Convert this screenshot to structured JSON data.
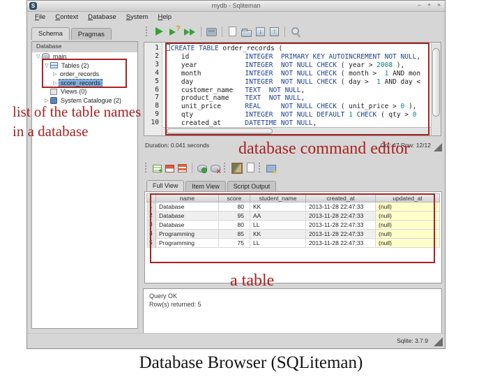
{
  "window": {
    "title": "mydb - Sqliteman",
    "app_icon": "S",
    "controls": [
      "–",
      "+",
      "×"
    ],
    "menu": [
      "File",
      "Context",
      "Database",
      "System",
      "Help"
    ],
    "schema_tabs": [
      {
        "label": "Schema",
        "active": true
      },
      {
        "label": "Pragmas",
        "active": false
      }
    ]
  },
  "toolbar_main": {
    "icons": [
      {
        "name": "toolbar-grip",
        "kind": "grip"
      },
      {
        "name": "run-sql-icon",
        "kind": "run"
      },
      {
        "name": "explain-query-icon",
        "kind": "explain"
      },
      {
        "name": "run-all-icon",
        "kind": "runall"
      },
      {
        "name": "separator",
        "kind": "sep"
      },
      {
        "name": "sql-console-icon",
        "kind": "console"
      },
      {
        "name": "separator",
        "kind": "sep"
      },
      {
        "name": "new-file-icon",
        "kind": "new"
      },
      {
        "name": "open-file-icon",
        "kind": "open"
      },
      {
        "name": "save-icon",
        "kind": "save"
      },
      {
        "name": "save-as-icon",
        "kind": "saveas"
      },
      {
        "name": "separator",
        "kind": "sep"
      },
      {
        "name": "search-icon",
        "kind": "search"
      }
    ]
  },
  "sidebar": {
    "header": "Database",
    "tree": [
      {
        "label": "main",
        "indent": 0,
        "expander": "open",
        "icon": "database-icon",
        "selected": false
      },
      {
        "label": "Tables (2)",
        "indent": 1,
        "expander": "open",
        "icon": "table-icon",
        "selected": false
      },
      {
        "label": "order_records",
        "indent": 2,
        "expander": "closed",
        "icon": "",
        "selected": false
      },
      {
        "label": "score_records",
        "indent": 2,
        "expander": "closed",
        "icon": "",
        "selected": true
      },
      {
        "label": "Views (0)",
        "indent": 1,
        "expander": "none",
        "icon": "views-icon",
        "selected": false
      },
      {
        "label": "System Catalogue (2)",
        "indent": 1,
        "expander": "closed",
        "icon": "catalogue-icon",
        "selected": false
      }
    ]
  },
  "editor": {
    "lines": [
      {
        "num": "1",
        "segs": [
          [
            "b",
            ""
          ],
          [
            "k",
            "CREATE"
          ],
          [
            "c",
            " "
          ],
          [
            "k",
            "TABLE"
          ],
          [
            "c",
            " order_records ("
          ]
        ]
      },
      {
        "num": "2",
        "segs": [
          [
            "c",
            "    id              "
          ],
          [
            "k",
            "INTEGER"
          ],
          [
            "c",
            "  "
          ],
          [
            "k",
            "PRIMARY KEY AUTOINCREMENT NOT NULL"
          ],
          [
            "c",
            ","
          ]
        ]
      },
      {
        "num": "3",
        "segs": [
          [
            "c",
            "    year            "
          ],
          [
            "k",
            "INTEGER"
          ],
          [
            "c",
            "  "
          ],
          [
            "k",
            "NOT NULL CHECK"
          ],
          [
            "c",
            " ( year > "
          ],
          [
            "n",
            "2008"
          ],
          [
            "c",
            " ),"
          ]
        ]
      },
      {
        "num": "4",
        "segs": [
          [
            "c",
            "    month           "
          ],
          [
            "k",
            "INTEGER"
          ],
          [
            "c",
            "  "
          ],
          [
            "k",
            "NOT NULL CHECK"
          ],
          [
            "c",
            " ( month >  "
          ],
          [
            "n",
            "1"
          ],
          [
            "c",
            " AND mon"
          ]
        ]
      },
      {
        "num": "5",
        "segs": [
          [
            "c",
            "    day             "
          ],
          [
            "k",
            "INTEGER"
          ],
          [
            "c",
            "  "
          ],
          [
            "k",
            "NOT NULL CHECK"
          ],
          [
            "c",
            " ( day >  "
          ],
          [
            "n",
            "1"
          ],
          [
            "c",
            " AND day <"
          ]
        ]
      },
      {
        "num": "6",
        "segs": [
          [
            "c",
            "    customer_name   "
          ],
          [
            "k",
            "TEXT"
          ],
          [
            "c",
            "  "
          ],
          [
            "k",
            "NOT NULL"
          ],
          [
            "c",
            ","
          ]
        ]
      },
      {
        "num": "7",
        "segs": [
          [
            "c",
            "    product_name    "
          ],
          [
            "k",
            "TEXT"
          ],
          [
            "c",
            "  "
          ],
          [
            "k",
            "NOT NULL"
          ],
          [
            "c",
            ","
          ]
        ]
      },
      {
        "num": "8",
        "segs": [
          [
            "c",
            "    unit_price      "
          ],
          [
            "k",
            "REAL"
          ],
          [
            "c",
            "     "
          ],
          [
            "k",
            "NOT NULL CHECK"
          ],
          [
            "c",
            " ( unit_price > "
          ],
          [
            "n",
            "0"
          ],
          [
            "c",
            " ),"
          ]
        ]
      },
      {
        "num": "9",
        "segs": [
          [
            "c",
            "    qty             "
          ],
          [
            "k",
            "INTEGER"
          ],
          [
            "c",
            "  "
          ],
          [
            "k",
            "NOT NULL DEFAULT"
          ],
          [
            "c",
            " "
          ],
          [
            "n",
            "1"
          ],
          [
            "c",
            " "
          ],
          [
            "k",
            "CHECK"
          ],
          [
            "c",
            " ( qty > "
          ],
          [
            "n",
            "0"
          ]
        ]
      },
      {
        "num": "10",
        "segs": [
          [
            "c",
            "    created_at      "
          ],
          [
            "k",
            "DATETIME"
          ],
          [
            "c",
            " "
          ],
          [
            "k",
            "NOT NULL"
          ],
          [
            "c",
            ","
          ]
        ]
      }
    ]
  },
  "editor_status": {
    "left": "Duration: 0.041 seconds",
    "right": "Col: 47 Row: 12/12"
  },
  "toolbar_results": {
    "icons": [
      {
        "name": "toolbar-grip",
        "kind": "grip"
      },
      {
        "name": "add-row-icon",
        "kind": "addrow"
      },
      {
        "name": "remove-row-icon",
        "kind": "delrow"
      },
      {
        "name": "remove-all-rows-icon",
        "kind": "delrows"
      },
      {
        "name": "separator",
        "kind": "sep"
      },
      {
        "name": "commit-icon",
        "kind": "commit"
      },
      {
        "name": "rollback-icon",
        "kind": "rollback"
      },
      {
        "name": "toolbar-grip",
        "kind": "grip"
      },
      {
        "name": "blob-preview-icon",
        "kind": "blob"
      },
      {
        "name": "paste-icon",
        "kind": "page"
      },
      {
        "name": "toolbar-grip",
        "kind": "grip"
      },
      {
        "name": "create-view-icon",
        "kind": "view"
      }
    ]
  },
  "results": {
    "tabs": [
      {
        "label": "Full View",
        "active": true
      },
      {
        "label": "Item View",
        "active": false
      },
      {
        "label": "Script Output",
        "active": false
      }
    ],
    "columns": [
      "name",
      "score",
      "student_name",
      "created_at",
      "updated_at"
    ],
    "rows": [
      [
        "Database",
        "80",
        "KK",
        "2013-11-28 22:47:33",
        "(null)"
      ],
      [
        "Database",
        "95",
        "AA",
        "2013-11-28 22:47:33",
        "(null)"
      ],
      [
        "Database",
        "80",
        "LL",
        "2013-11-28 22:47:33",
        "(null)"
      ],
      [
        "Programming",
        "85",
        "KK",
        "2013-11-28 22:47:33",
        "(null)"
      ],
      [
        "Programming",
        "75",
        "LL",
        "2013-11-28 22:47:33",
        "(null)"
      ]
    ]
  },
  "message": {
    "lines": [
      "Query OK",
      "Row(s) returned: 5"
    ]
  },
  "statusbar": {
    "sqlite_version": "Sqlite: 3.7.9"
  },
  "annotations": {
    "color": "#a82222",
    "sidebar_note": [
      "list of the table names",
      "in a database"
    ],
    "editor_note": "database command editor",
    "table_note": "a table"
  },
  "caption": "Database Browser (SQLiteman)"
}
